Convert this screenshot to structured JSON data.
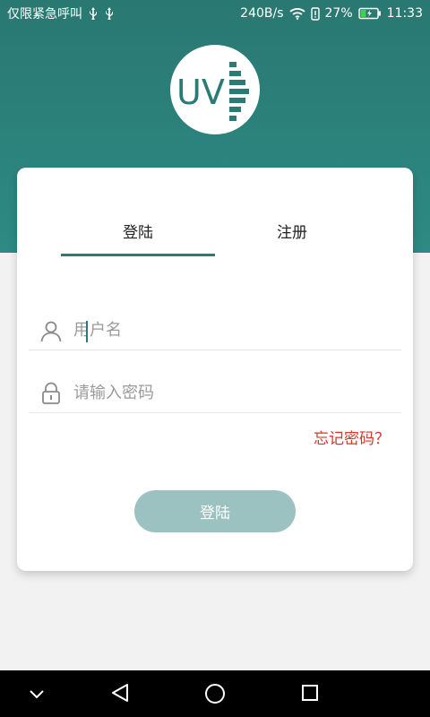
{
  "status_bar": {
    "carrier": "仅限紧急呼叫",
    "speed": "240B/s",
    "battery_percent": "27%",
    "time": "11:33",
    "icons": [
      "usb-icon",
      "usb-icon",
      "wifi-icon",
      "alert-icon",
      "battery-charging-icon"
    ]
  },
  "logo": {
    "text": "UV"
  },
  "tabs": [
    {
      "label": "登陆",
      "active": true
    },
    {
      "label": "注册",
      "active": false
    }
  ],
  "form": {
    "username_placeholder": "用户名",
    "username_value": "",
    "password_placeholder": "请输入密码",
    "password_value": "",
    "forgot_label": "忘记密码？",
    "submit_label": "登陆"
  },
  "colors": {
    "primary": "#2a7b75",
    "button_disabled": "#9bc2c0",
    "forgot": "#d9362b"
  },
  "nav": {
    "icons": [
      "chevron-down-icon",
      "back-icon",
      "home-icon",
      "recents-icon"
    ]
  }
}
